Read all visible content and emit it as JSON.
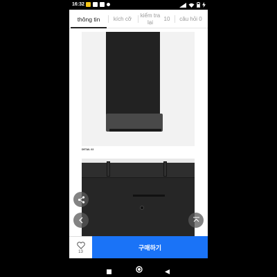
{
  "status_bar": {
    "time": "16:32",
    "notification_icons": [
      "app-icon",
      "chat-icon",
      "chat-icon",
      "notification-icon"
    ],
    "system_icons": [
      "wifi-icon",
      "signal-icon",
      "battery-icon",
      "charging-icon"
    ]
  },
  "tabs": [
    {
      "label": "thông tin",
      "active": true
    },
    {
      "label": "kích cỡ",
      "active": false
    },
    {
      "label": "kiểm tra lại",
      "active": false
    },
    {
      "label": "10",
      "active": false
    },
    {
      "label": "câu hỏi 0",
      "active": false
    }
  ],
  "content": {
    "detail_label": "DETAIL 03"
  },
  "floating": {
    "share_icon": "share-icon",
    "prev_icon": "chevron-left-icon",
    "top_icon": "scroll-top-icon"
  },
  "bottom_bar": {
    "wish_count": "13",
    "buy_label": "구매하기",
    "buy_color": "#1a73f7"
  },
  "nav_bar": {
    "icons": [
      "recents-icon",
      "home-icon",
      "back-icon"
    ]
  }
}
